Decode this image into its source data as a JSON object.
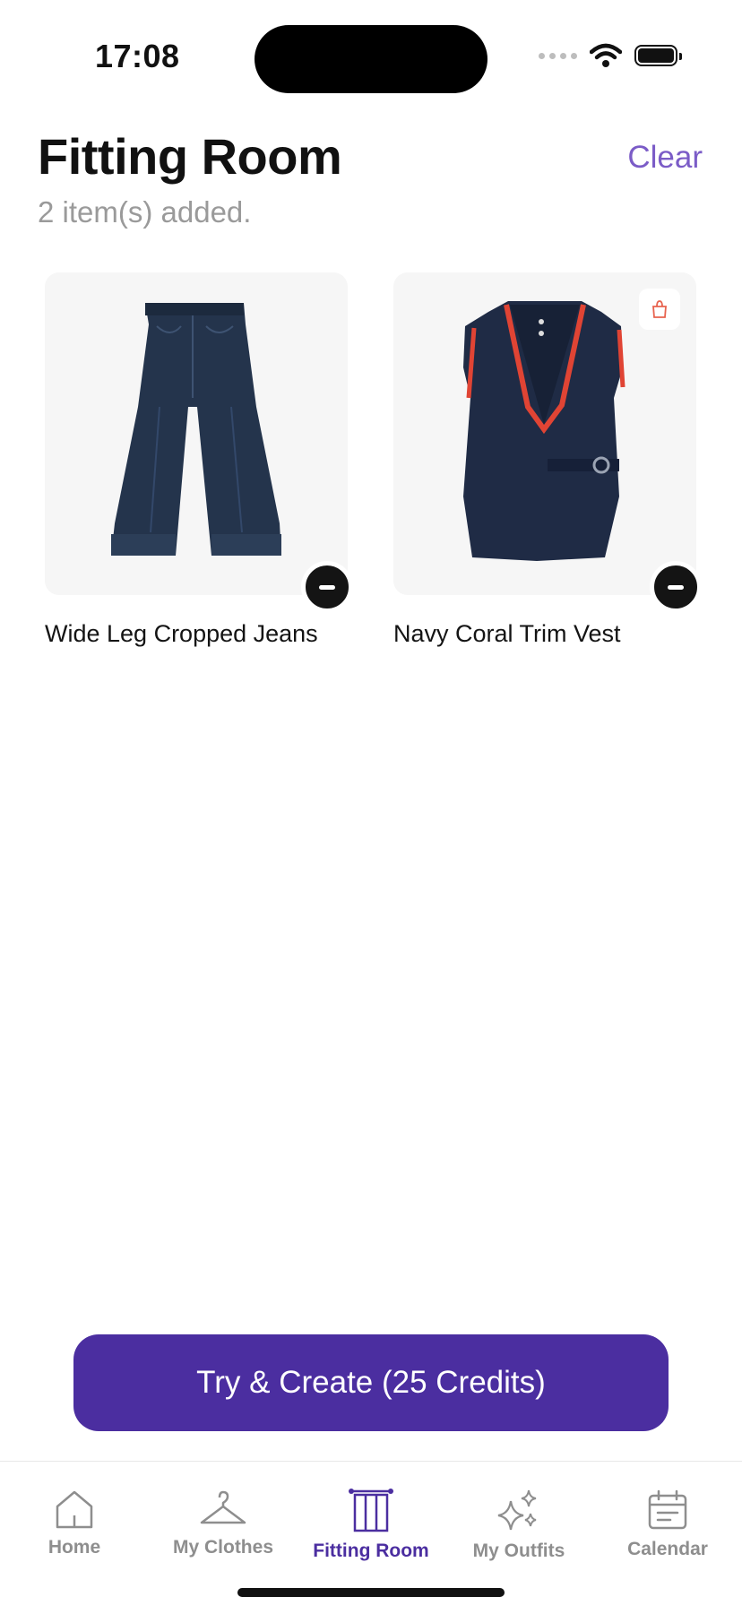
{
  "status_bar": {
    "time": "17:08"
  },
  "header": {
    "title": "Fitting Room",
    "subtitle": "2 item(s) added.",
    "clear_label": "Clear"
  },
  "items": [
    {
      "name": "Wide Leg Cropped Jeans",
      "icon": "jeans-image"
    },
    {
      "name": "Navy Coral Trim Vest",
      "icon": "vest-image",
      "badge_icon": "shopping-bag-icon"
    }
  ],
  "cta": {
    "label": "Try & Create (25 Credits)"
  },
  "tabs": [
    {
      "label": "Home",
      "icon": "home-icon",
      "active": false
    },
    {
      "label": "My Clothes",
      "icon": "hanger-icon",
      "active": false
    },
    {
      "label": "Fitting Room",
      "icon": "fitting-room-icon",
      "active": true
    },
    {
      "label": "My Outfits",
      "icon": "sparkles-icon",
      "active": false
    },
    {
      "label": "Calendar",
      "icon": "calendar-icon",
      "active": false
    }
  ],
  "colors": {
    "accent": "#4b2ea0",
    "clear_link": "#7b5cc7",
    "badge_bag": "#e8634f"
  }
}
